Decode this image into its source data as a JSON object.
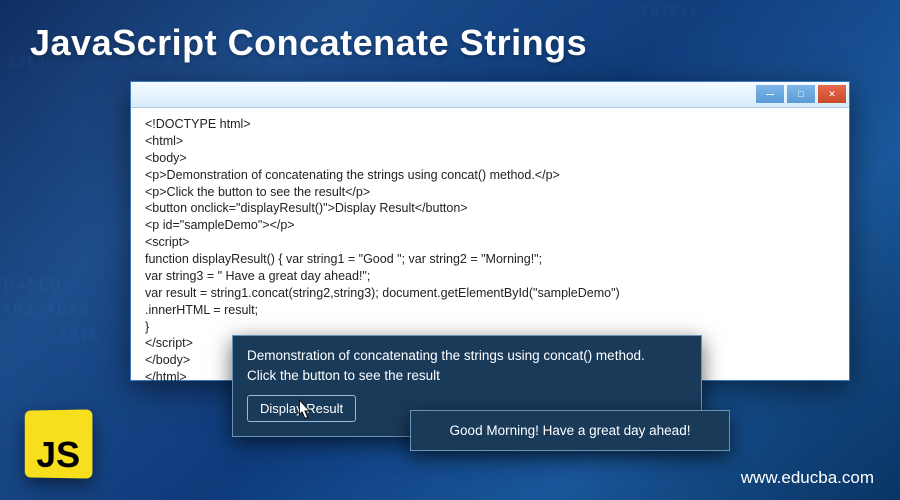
{
  "page": {
    "title": "JavaScript Concatenate Strings",
    "website": "www.educba.com"
  },
  "logo": {
    "text": "JS"
  },
  "hex": {
    "h1": "F07E2F",
    "h2": "23E7",
    "h3": "D45CD",
    "h4": "AB2 AB28",
    "h5": "E046"
  },
  "code_window": {
    "lines": [
      "<!DOCTYPE html>",
      "<html>",
      "<body>",
      "<p>Demonstration of concatenating the strings using concat() method.</p>",
      "<p>Click the button to see the result</p>",
      "<button onclick=\"displayResult()\">Display Result</button>",
      "<p id=\"sampleDemo\"></p>",
      "<script>",
      "function displayResult() { var string1 = \"Good \"; var string2 = \"Morning!\";",
      "var string3 = \" Have a great day ahead!\";",
      "var result = string1.concat(string2,string3); document.getElementById(\"sampleDemo\")",
      ".innerHTML = result;",
      "}",
      "</script>",
      "</body>",
      "</html>"
    ]
  },
  "popup1": {
    "line1": "Demonstration of concatenating the strings using concat() method.",
    "line2": "Click the button to see the result",
    "button": "Display Result"
  },
  "popup2": {
    "text": "Good Morning! Have a great day ahead!"
  }
}
